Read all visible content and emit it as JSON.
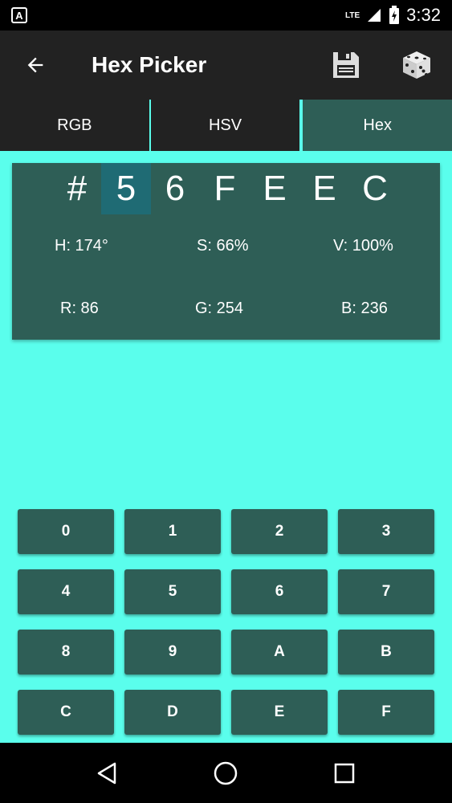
{
  "status_bar": {
    "time": "3:32",
    "network": "LTE",
    "notification_icon": "a-notification-icon"
  },
  "app_bar": {
    "title": "Hex Picker",
    "back_icon": "arrow-left-icon",
    "save_icon": "floppy-disk-icon",
    "random_icon": "dice-icon"
  },
  "tabs": [
    {
      "label": "RGB",
      "active": false
    },
    {
      "label": "HSV",
      "active": false
    },
    {
      "label": "Hex",
      "active": true
    }
  ],
  "hex": {
    "prefix": "#",
    "digits": [
      "5",
      "6",
      "F",
      "E",
      "E",
      "C"
    ],
    "selected_index": 0
  },
  "hsv": {
    "h": "H: 174°",
    "s": "S: 66%",
    "v": "V: 100%"
  },
  "rgb": {
    "r": "R: 86",
    "g": "G: 254",
    "b": "B: 236"
  },
  "keypad": {
    "keys": [
      "0",
      "1",
      "2",
      "3",
      "4",
      "5",
      "6",
      "7",
      "8",
      "9",
      "A",
      "B",
      "C",
      "D",
      "E",
      "F"
    ]
  },
  "colors": {
    "background": "#5AFEEC",
    "panel": "#2E5E56",
    "app_bar": "#222222",
    "selected_digit": "#1F6B74"
  }
}
